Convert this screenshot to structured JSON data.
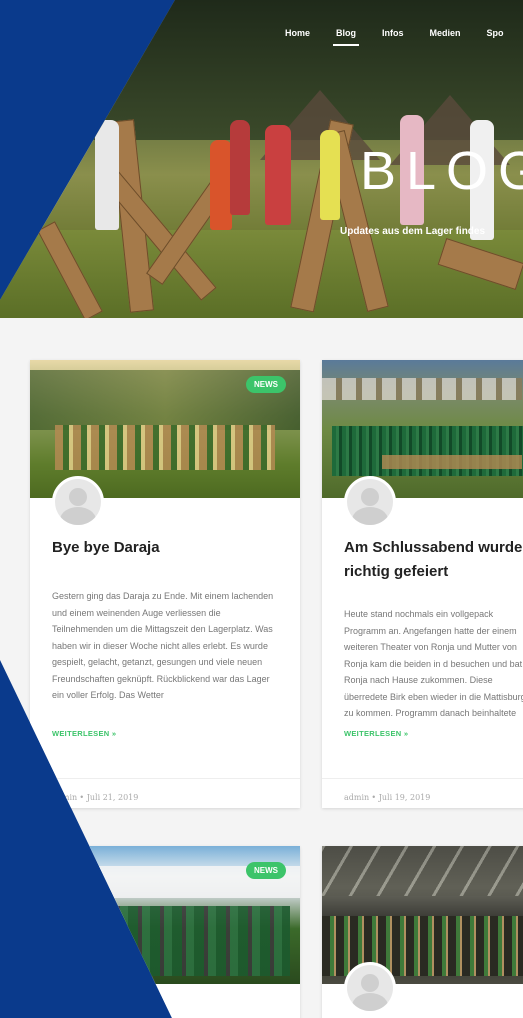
{
  "nav": {
    "items": [
      "Home",
      "Blog",
      "Infos",
      "Medien",
      "Spo"
    ],
    "active": "Blog"
  },
  "hero": {
    "title": "BLOG",
    "subtitle": "Updates aus dem Lager findes"
  },
  "colors": {
    "accent": "#3cc46a",
    "frame": "#0a3a8c"
  },
  "posts": [
    {
      "badge": "NEWS",
      "title": "Bye bye Daraja",
      "excerpt": "Gestern ging das Daraja zu Ende. Mit einem lachenden und einem weinenden Auge verliessen die Teilnehmenden um die Mittagszeit den Lagerplatz. Was haben wir in dieser Woche nicht alles erlebt. Es wurde gespielt, gelacht, getanzt, gesungen und viele neuen Freundschaften geknüpft. Rückblickend war das Lager ein voller Erfolg. Das Wetter",
      "more": "WEITERLESEN »",
      "author": "admin",
      "date": "Juli 21, 2019"
    },
    {
      "badge": "",
      "title": "Am Schlussabend wurde richtig gefeiert",
      "excerpt": "Heute stand nochmals ein vollgepack Programm an. Angefangen hatte der einem weiteren Theater von Ronja und Mutter von Ronja kam die beiden in d besuchen und bat Ronja nach Hause zukommen. Diese überredete Birk eben wieder in die Mattisburg zu kommen. Programm danach beinhaltete",
      "more": "WEITERLESEN »",
      "author": "admin",
      "date": "Juli 19, 2019"
    },
    {
      "badge": "NEWS"
    },
    {
      "badge": ""
    }
  ]
}
